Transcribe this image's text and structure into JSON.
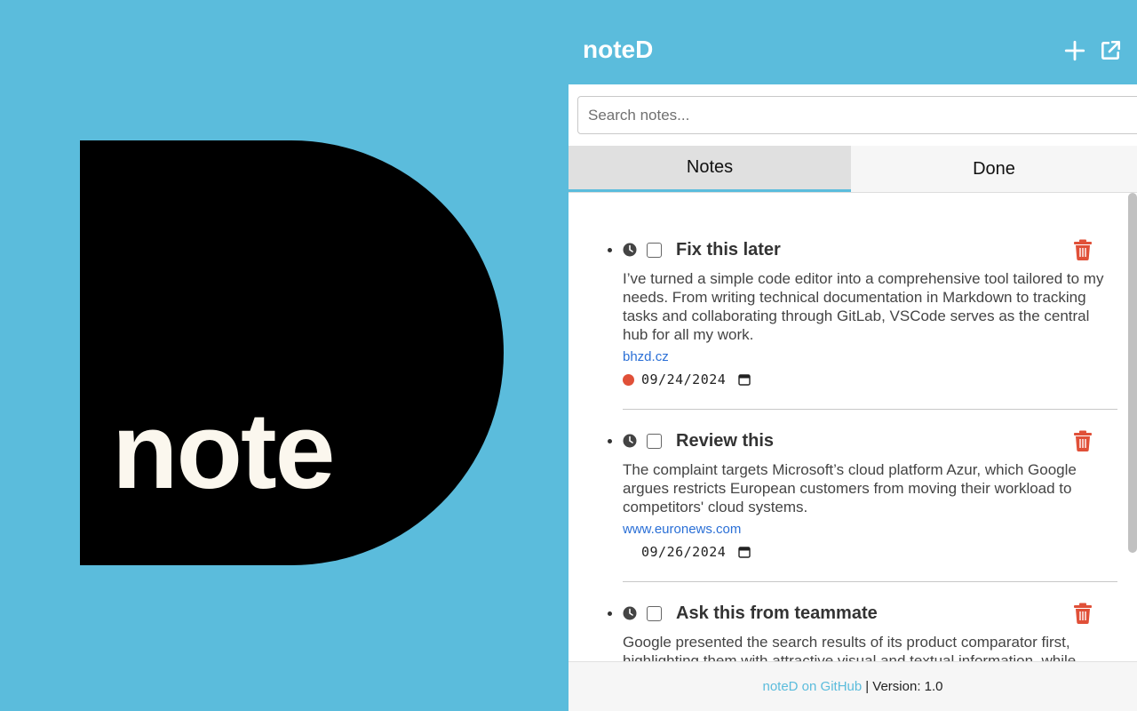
{
  "logo": {
    "text": "note"
  },
  "header": {
    "title": "noteD",
    "add_icon": "plus-icon",
    "open_icon": "external-link-icon"
  },
  "search": {
    "placeholder": "Search notes...",
    "value": ""
  },
  "tabs": [
    {
      "label": "Notes",
      "active": true
    },
    {
      "label": "Done",
      "active": false
    }
  ],
  "notes": [
    {
      "title": "Fix this later",
      "text": "I’ve turned a simple code editor into a comprehensive tool tailored to my needs. From writing technical documentation in Markdown to tracking tasks and collaborating through GitLab, VSCode serves as the central hub for all my work.",
      "link": "bhzd.cz",
      "date": "09/24/2024",
      "overdue": true
    },
    {
      "title": "Review this",
      "text": "The complaint targets Microsoft’s cloud platform Azur, which Google argues restricts European customers from moving their workload to competitors' cloud systems.",
      "link": "www.euronews.com",
      "date": "09/26/2024",
      "overdue": false
    },
    {
      "title": "Ask this from teammate",
      "text": "Google presented the search results of its product comparator first, highlighting them with attractive visual and textual information, while",
      "link": "",
      "date": "",
      "overdue": false
    }
  ],
  "footer": {
    "link": "noteD on GitHub",
    "version": "| Version: 1.0"
  },
  "colors": {
    "accent": "#5bbcdc",
    "delete": "#e05038",
    "link": "#2a6fd6"
  }
}
